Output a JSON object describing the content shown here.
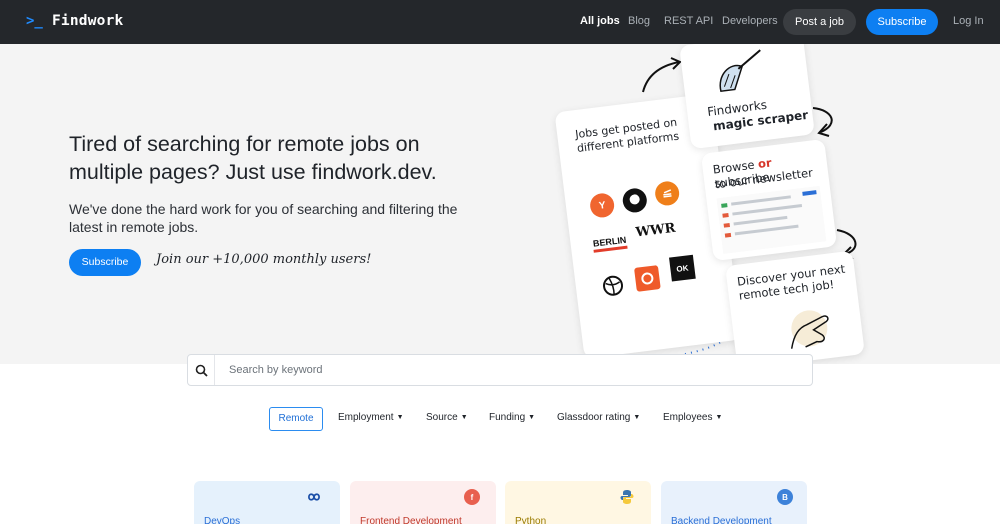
{
  "nav": {
    "brand": "Findwork",
    "links": [
      "All jobs",
      "Blog",
      "REST API",
      "Developers"
    ],
    "post_job": "Post a job",
    "subscribe": "Subscribe",
    "login": "Log In"
  },
  "hero": {
    "title": "Tired of searching for remote jobs on multiple pages? Just use findwork.dev.",
    "subtitle": "We've done the hard work for you of searching and filtering the latest in remote jobs.",
    "subscribe": "Subscribe",
    "note": "Join our +10,000 monthly users!"
  },
  "illustration": {
    "card1": "Jobs get posted on different platforms",
    "card2_line1": "Findworks",
    "card2_line2": "magic scraper",
    "card3_a": "Browse ",
    "card3_or": "or",
    "card3_b": " subscribe",
    "card3_line2": "to our newsletter",
    "card4": "Discover your next remote tech job!",
    "logos": [
      "Y",
      "BERLIN",
      "WWR",
      "OK"
    ]
  },
  "search": {
    "placeholder": "Search by keyword"
  },
  "filters": {
    "remote": "Remote",
    "items": [
      "Employment",
      "Source",
      "Funding",
      "Glassdoor rating",
      "Employees"
    ]
  },
  "categories": [
    {
      "label": "DevOps",
      "color": "#2a6fd6",
      "bg": "#e5f1fc",
      "icon": "infinity-icon"
    },
    {
      "label": "Frontend Development",
      "color": "#c0392b",
      "bg": "#fdeeee",
      "icon": "f"
    },
    {
      "label": "Python",
      "color": "#9a7b00",
      "bg": "#fff7e3",
      "icon": "python-icon"
    },
    {
      "label": "Backend Development",
      "color": "#2a6fd6",
      "bg": "#e8f1fc",
      "icon": "B"
    }
  ]
}
